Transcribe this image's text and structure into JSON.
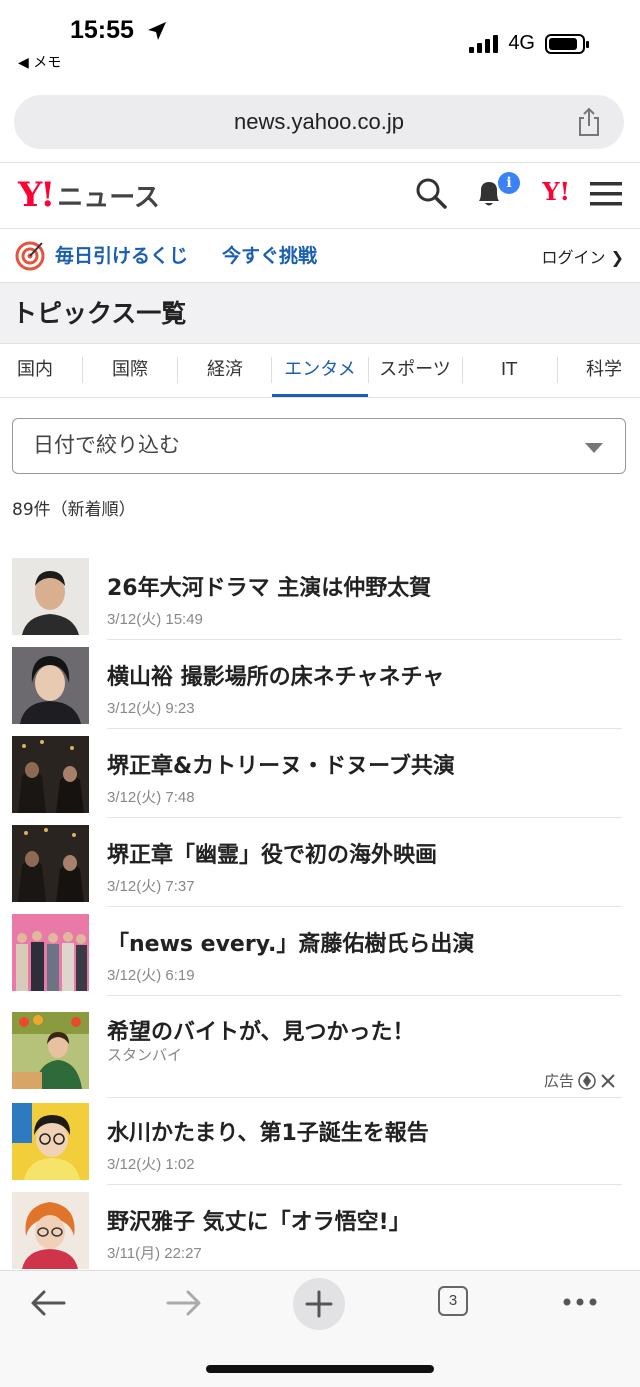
{
  "status_bar": {
    "time": "15:55",
    "back_label": "◀ メモ",
    "network": "4G"
  },
  "browser": {
    "url": "news.yahoo.co.jp"
  },
  "header": {
    "logo_mark": "Y!",
    "logo_text": "ニュース",
    "bell_badge": "i",
    "y_mark": "Y!"
  },
  "promo": {
    "text": "毎日引けるくじ",
    "cta": "今すぐ挑戦",
    "login": "ログイン ❯"
  },
  "page_title": "トピックス一覧",
  "tabs": [
    {
      "label": "国内"
    },
    {
      "label": "国際"
    },
    {
      "label": "経済"
    },
    {
      "label": "エンタメ"
    },
    {
      "label": "スポーツ"
    },
    {
      "label": "IT"
    },
    {
      "label": "科学"
    }
  ],
  "active_tab": "エンタメ",
  "filter": {
    "label": "日付で絞り込む"
  },
  "result_count": "89件（新着順）",
  "items": [
    {
      "title": "26年大河ドラマ 主演は仲野太賀",
      "date": "3/12(火) 15:49"
    },
    {
      "title": "横山裕 撮影場所の床ネチャネチャ",
      "date": "3/12(火) 9:23"
    },
    {
      "title": "堺正章&カトリーヌ・ドヌーブ共演",
      "date": "3/12(火) 7:48"
    },
    {
      "title": "堺正章「幽霊」役で初の海外映画",
      "date": "3/12(火) 7:37"
    },
    {
      "title": "「news every.」斎藤佑樹氏ら出演",
      "date": "3/12(火) 6:19"
    },
    {
      "title": "希望のバイトが、見つかった！",
      "date": "スタンバイ",
      "ad_label": "広告"
    },
    {
      "title": "水川かたまり、第1子誕生を報告",
      "date": "3/12(火) 1:02"
    },
    {
      "title": "野沢雅子 気丈に「オラ悟空!」",
      "date": "3/11(月) 22:27"
    }
  ],
  "toolbar": {
    "tab_count": "3"
  },
  "colors": {
    "accent_blue": "#1a5fb4",
    "brand_red": "#ff0033"
  }
}
